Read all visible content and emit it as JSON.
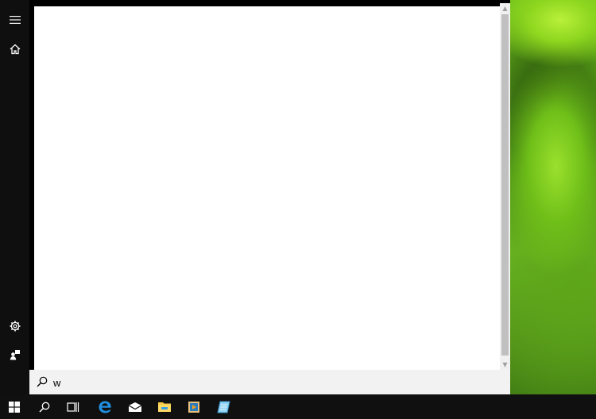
{
  "search": {
    "query": "w",
    "placeholder": ""
  },
  "left_rail": {
    "icons": [
      "hamburger-icon",
      "home-icon",
      "settings-gear-icon",
      "user-feedback-icon"
    ]
  },
  "taskbar": {
    "icons": [
      "windows-start-icon",
      "search-icon",
      "task-view-icon",
      "edge-icon",
      "mail-icon",
      "file-explorer-icon",
      "media-player-icon",
      "notepad-icon"
    ]
  },
  "colors": {
    "taskbar": "#101010",
    "rail": "#0f0f0f",
    "accent_blue": "#1f8ee0",
    "search_box": "#f2f2f2"
  }
}
